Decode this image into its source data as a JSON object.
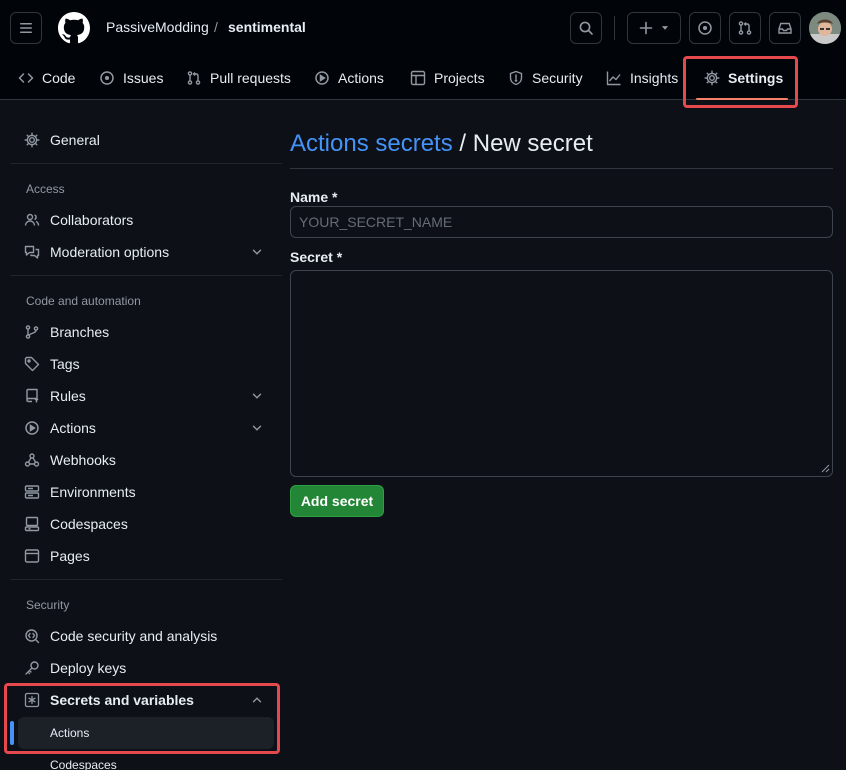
{
  "header": {
    "owner": "PassiveModding",
    "slash": "/",
    "repo": "sentimental"
  },
  "tabs": [
    {
      "label": "Code",
      "icon": "code-icon"
    },
    {
      "label": "Issues",
      "icon": "issue-opened-icon"
    },
    {
      "label": "Pull requests",
      "icon": "git-pull-request-icon"
    },
    {
      "label": "Actions",
      "icon": "play-icon"
    },
    {
      "label": "Projects",
      "icon": "table-icon"
    },
    {
      "label": "Security",
      "icon": "shield-icon"
    },
    {
      "label": "Insights",
      "icon": "graph-icon"
    },
    {
      "label": "Settings",
      "icon": "gear-icon",
      "active": true
    }
  ],
  "sidebar": {
    "general": "General",
    "access_heading": "Access",
    "collaborators": "Collaborators",
    "moderation": "Moderation options",
    "code_heading": "Code and automation",
    "branches": "Branches",
    "tags": "Tags",
    "rules": "Rules",
    "actions": "Actions",
    "webhooks": "Webhooks",
    "environments": "Environments",
    "codespaces": "Codespaces",
    "pages": "Pages",
    "security_heading": "Security",
    "code_security": "Code security and analysis",
    "deploy_keys": "Deploy keys",
    "secrets": "Secrets and variables",
    "secrets_actions": "Actions",
    "secrets_codespaces": "Codespaces"
  },
  "main": {
    "breadcrumb": "Actions secrets",
    "separator": "/",
    "title": "New secret",
    "name_label": "Name *",
    "name_placeholder": "YOUR_SECRET_NAME",
    "secret_label": "Secret *",
    "submit": "Add secret"
  },
  "colors": {
    "accent": "#4493f8",
    "primary_button": "#238636",
    "highlight": "#e5484d",
    "background": "#0d1117"
  }
}
